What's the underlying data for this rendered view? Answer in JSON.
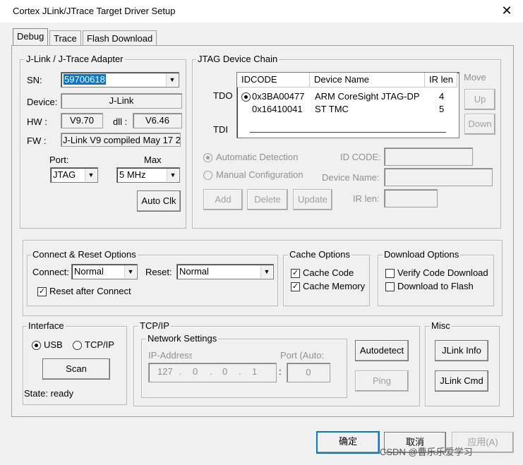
{
  "window": {
    "title": "Cortex JLink/JTrace Target Driver Setup",
    "close": "✕"
  },
  "tabs": [
    {
      "label": "Debug"
    },
    {
      "label": "Trace"
    },
    {
      "label": "Flash Download"
    }
  ],
  "adapter": {
    "group_label": "J-Link / J-Trace Adapter",
    "sn_label": "SN:",
    "sn_value": "59700618",
    "device_label": "Device:",
    "device_value": "J-Link",
    "hw_label": "HW :",
    "hw_value": "V9.70",
    "dll_label": "dll :",
    "dll_value": "V6.46",
    "fw_label": "FW :",
    "fw_value": "J-Link V9 compiled May 17 2",
    "port_label": "Port:",
    "port_value": "JTAG",
    "max_label": "Max",
    "max_value": "5 MHz",
    "autoclk_label": "Auto Clk"
  },
  "jtag": {
    "group_label": "JTAG Device Chain",
    "tdo_label": "TDO",
    "tdi_label": "TDI",
    "columns": [
      "IDCODE",
      "Device Name",
      "IR len"
    ],
    "rows": [
      {
        "idcode": "0x3BA00477",
        "name": "ARM CoreSight JTAG-DP",
        "irlen": "4"
      },
      {
        "idcode": "0x16410041",
        "name": "ST TMC",
        "irlen": "5"
      }
    ],
    "move_label": "Move",
    "up_label": "Up",
    "down_label": "Down",
    "auto_detect_label": "Automatic Detection",
    "manual_config_label": "Manual Configuration",
    "id_code_label": "ID CODE:",
    "device_name_label": "Device Name:",
    "ir_len_label": "IR len:",
    "add_label": "Add",
    "delete_label": "Delete",
    "update_label": "Update"
  },
  "connect_reset": {
    "group_label": "Connect & Reset Options",
    "connect_label": "Connect:",
    "connect_value": "Normal",
    "reset_label": "Reset:",
    "reset_value": "Normal",
    "reset_after_connect_label": "Reset after Connect",
    "reset_after_connect_checked": true
  },
  "cache": {
    "group_label": "Cache Options",
    "cache_code_label": "Cache Code",
    "cache_code_checked": true,
    "cache_memory_label": "Cache Memory",
    "cache_memory_checked": true
  },
  "download": {
    "group_label": "Download Options",
    "verify_label": "Verify Code Download",
    "verify_checked": false,
    "flash_label": "Download to Flash",
    "flash_checked": false
  },
  "interface": {
    "group_label": "Interface",
    "usb_label": "USB",
    "tcpip_label": "TCP/IP",
    "scan_label": "Scan",
    "state_label": "State: ready"
  },
  "tcpip": {
    "group_label": "TCP/IP",
    "network_label": "Network Settings",
    "ip_label": "IP-Address",
    "port_label": "Port (Auto:",
    "ip": [
      "127",
      "0",
      "0",
      "1"
    ],
    "port_value": "0",
    "autodetect_label": "Autodetect",
    "ping_label": "Ping"
  },
  "misc": {
    "group_label": "Misc",
    "jlink_info_label": "JLink Info",
    "jlink_cmd_label": "JLink Cmd"
  },
  "footer": {
    "ok_label": "确定",
    "cancel_label": "取消",
    "apply_label": "应用(A)"
  },
  "watermark": "CSDN @曹乐乐爱学习"
}
